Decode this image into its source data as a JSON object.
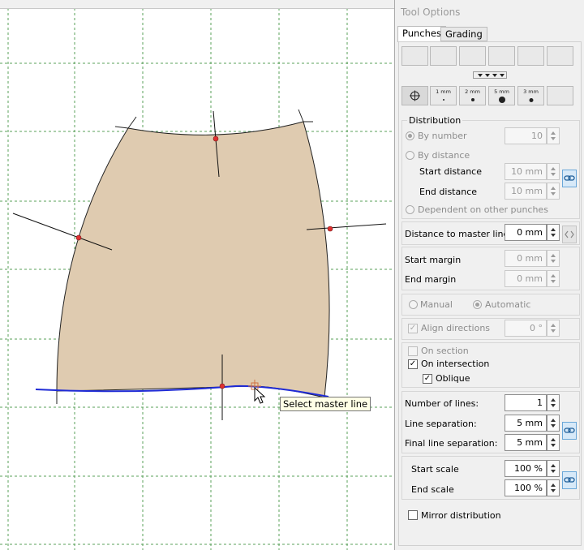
{
  "panel": {
    "title": "Tool Options",
    "tabs": [
      {
        "label": "Punches",
        "active": true
      },
      {
        "label": "Grading",
        "active": false
      }
    ]
  },
  "toolbar": {
    "punch_size_labels": [
      "1 mm",
      "2 mm",
      "5 mm",
      "3 mm"
    ]
  },
  "distribution": {
    "legend": "Distribution",
    "by_number_label": "By number",
    "by_number_value": "10",
    "by_distance_label": "By distance",
    "start_distance_label": "Start distance",
    "start_distance_value": "10 mm",
    "end_distance_label": "End distance",
    "end_distance_value": "10 mm",
    "dependent_label": "Dependent on other punches"
  },
  "distance_master": {
    "label": "Distance to master line",
    "value": "0 mm"
  },
  "margins": {
    "start_label": "Start margin",
    "start_value": "0 mm",
    "end_label": "End margin",
    "end_value": "0 mm"
  },
  "mode": {
    "manual_label": "Manual",
    "automatic_label": "Automatic",
    "selected": "Automatic"
  },
  "align": {
    "label": "Align directions",
    "value": "0 °",
    "checked": true
  },
  "section": {
    "on_section_label": "On section",
    "on_section_checked": false,
    "on_intersection_label": "On intersection",
    "on_intersection_checked": true,
    "oblique_label": "Oblique",
    "oblique_checked": true
  },
  "lines": {
    "number_label": "Number of lines:",
    "number_value": "1",
    "separation_label": "Line separation:",
    "separation_value": "5 mm",
    "final_separation_label": "Final line separation:",
    "final_separation_value": "5 mm"
  },
  "scale": {
    "start_label": "Start scale",
    "start_value": "100 %",
    "end_label": "End scale",
    "end_value": "100 %"
  },
  "mirror": {
    "label": "Mirror distribution",
    "checked": false
  },
  "tooltip": {
    "text": "Select master line"
  },
  "colors": {
    "pattern_fill": "#dfcbb0",
    "master_line": "#1f2bd6",
    "punch_point": "#e03030",
    "grid": "#5aa05a"
  }
}
